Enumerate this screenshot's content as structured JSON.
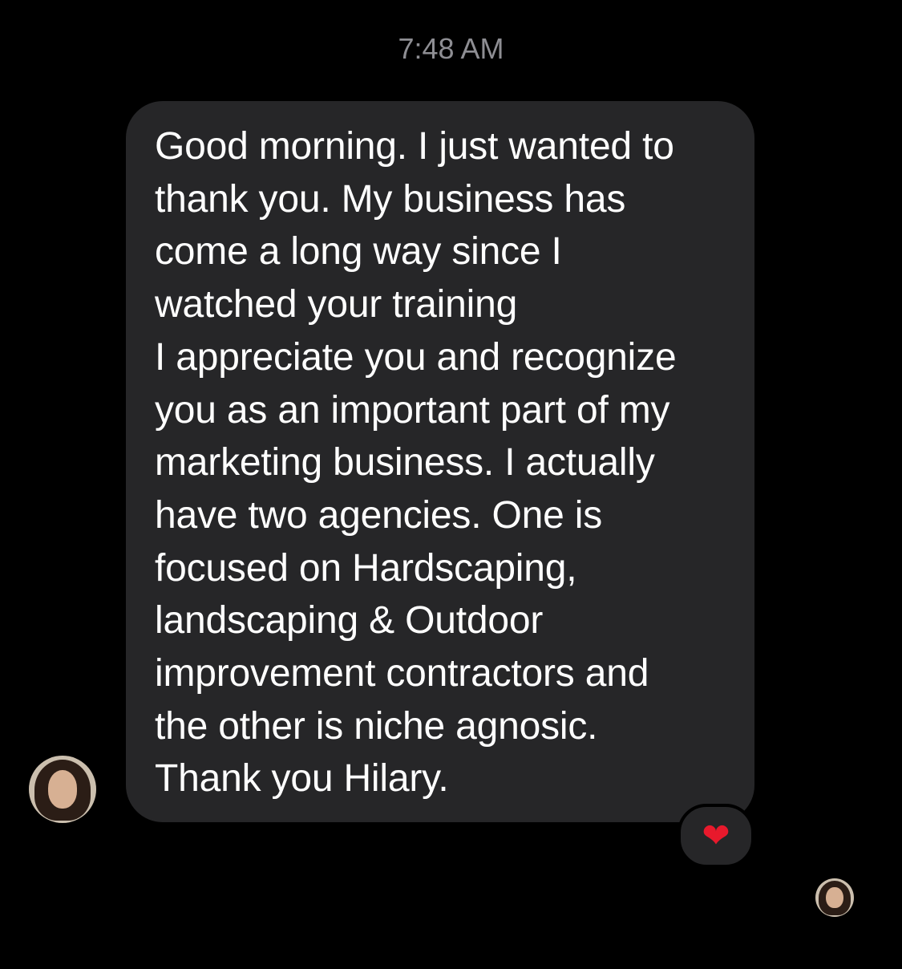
{
  "timestamp": "7:48 AM",
  "message": {
    "text": "Good morning. I just wanted to\nthank you. My business has\ncome a long way since I\nwatched your training\nI appreciate you and recognize\nyou as an important part of my\nmarketing business. I actually\nhave two agencies. One is\nfocused on Hardscaping,\nlandscaping & Outdoor\nimprovement contractors and\nthe other is niche agnosic.\nThank you Hilary."
  },
  "reaction": {
    "emoji": "❤",
    "icon": "heart-icon"
  },
  "colors": {
    "background": "#000000",
    "bubble": "#262628",
    "text": "#ffffff",
    "timestamp": "#8e8e93",
    "heart": "#e8192c"
  }
}
